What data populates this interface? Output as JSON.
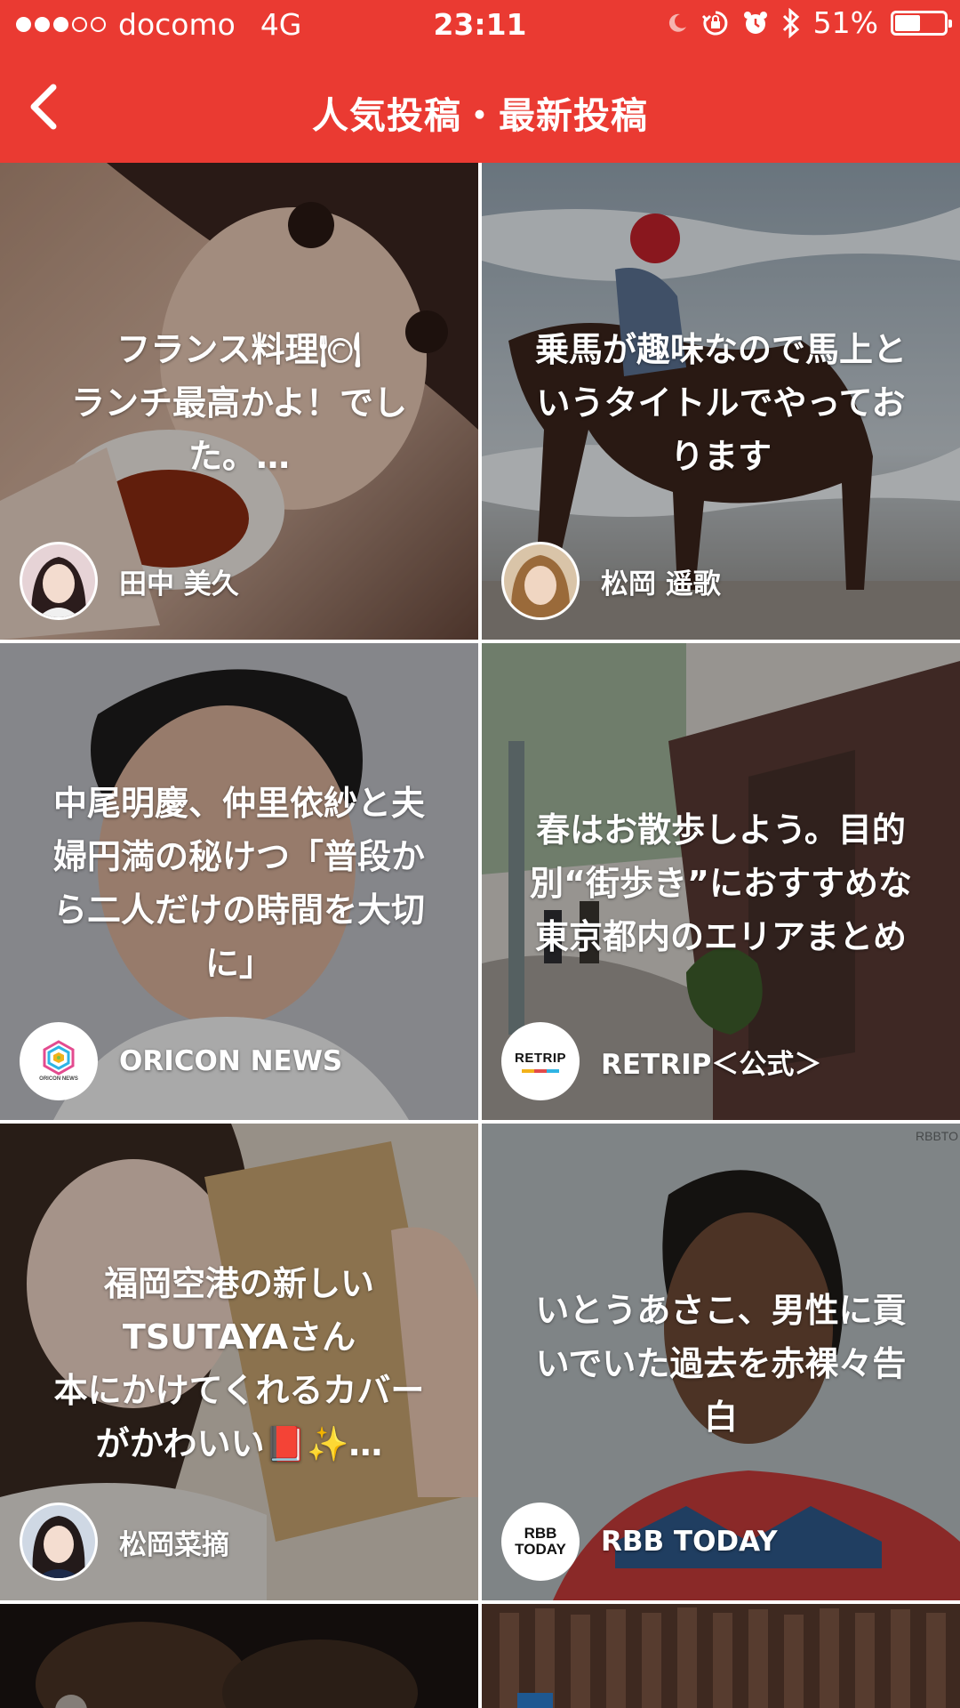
{
  "status_bar": {
    "carrier": "docomo",
    "network": "4G",
    "time": "23:11",
    "battery_percent_label": "51%",
    "battery_level": 0.51,
    "signal_bars_filled": 3,
    "signal_bars_total": 5,
    "icons": [
      "moon-icon",
      "rotation-lock-icon",
      "alarm-icon",
      "bluetooth-icon",
      "battery-icon"
    ]
  },
  "header": {
    "title": "人気投稿・最新投稿",
    "back_icon": "chevron-left-icon",
    "background_color": "#ea3a32"
  },
  "posts": [
    {
      "title": "フランス料理🍽\nランチ最高かよ！でし\nた。…",
      "author": "田中 美久",
      "avatar": "profile-photo"
    },
    {
      "title": "乗馬が趣味なので馬上と\nいうタイトルでやってお\nります",
      "author": "松岡 遥歌",
      "avatar": "profile-photo"
    },
    {
      "title": "中尾明慶、仲里依紗と夫\n婦円満の秘けつ「普段か\nら二人だけの時間を大切\nに」",
      "author": "ORICON NEWS",
      "avatar": "oricon-news-logo",
      "logo_text": "ORICON NEWS"
    },
    {
      "title": "春はお散歩しよう。目的\n別“街歩き”におすすめな\n東京都内のエリアまとめ",
      "author": "RETRIP＜公式＞",
      "avatar": "retrip-logo",
      "logo_text": "RETRIP"
    },
    {
      "title": "福岡空港の新しい\nTSUTAYAさん\n本にかけてくれるカバー\nがかわいい📕✨…",
      "author": "松岡菜摘",
      "avatar": "profile-photo"
    },
    {
      "title": "いとうあさこ、男性に貢\nいでいた過去を赤裸々告\n白",
      "author": "RBB TODAY",
      "avatar": "rbb-today-logo",
      "logo_text": "RBB\nTODAY",
      "watermark": "RBBTO"
    }
  ]
}
